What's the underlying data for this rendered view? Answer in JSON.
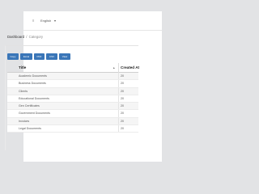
{
  "topbar": {
    "lang_icon": "≡",
    "language": "English",
    "lang_caret": "▾"
  },
  "breadcrumb": {
    "root": "Dashboard",
    "separator": "/",
    "current": "Category"
  },
  "toolbar": {
    "copy": "Copy",
    "excel": "Excel",
    "pdf": "PDF",
    "csv": "CSV",
    "view": "View"
  },
  "table": {
    "headers": {
      "title": "Title",
      "sort_icon": "▲",
      "created_at": "Created At"
    },
    "rows": [
      {
        "title": "Academic Documents",
        "created_at": "20"
      },
      {
        "title": "Business Documents",
        "created_at": "20"
      },
      {
        "title": "Clients",
        "created_at": "20"
      },
      {
        "title": "Educational Documents",
        "created_at": "20"
      },
      {
        "title": "Gen Certificates",
        "created_at": "20"
      },
      {
        "title": "Government Documents",
        "created_at": "20"
      },
      {
        "title": "Invoices",
        "created_at": "20"
      },
      {
        "title": "Legal Documents",
        "created_at": "20"
      }
    ]
  },
  "colors": {
    "background": "#e2e3e5",
    "panel": "#ffffff",
    "button": "#3a76b8",
    "row_alt": "#f5f5f5"
  }
}
